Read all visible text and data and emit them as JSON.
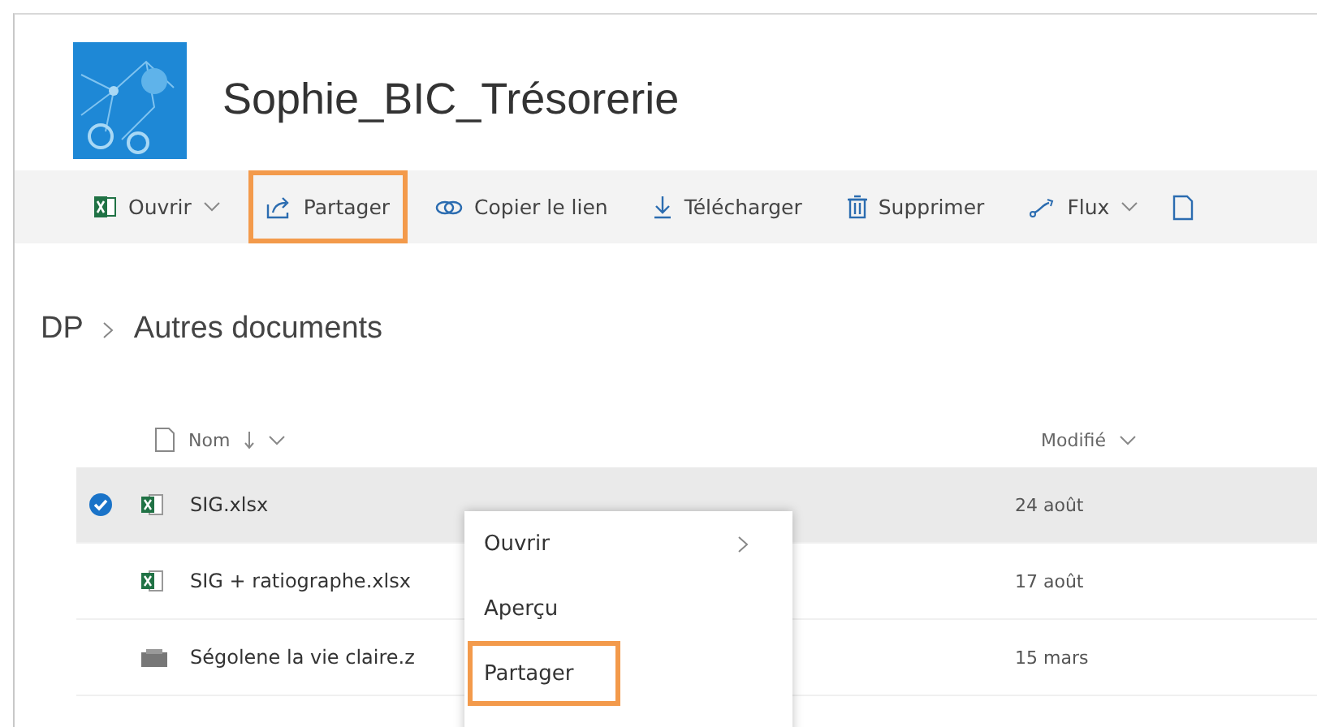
{
  "site": {
    "title": "Sophie_BIC_Trésorerie"
  },
  "toolbar": [
    {
      "label": "Ouvrir",
      "kind": "excel",
      "dropdown": true,
      "highlighted": false
    },
    {
      "label": "Partager",
      "kind": "share",
      "dropdown": false,
      "highlighted": true
    },
    {
      "label": "Copier le lien",
      "kind": "link",
      "dropdown": false,
      "highlighted": false
    },
    {
      "label": "Télécharger",
      "kind": "download",
      "dropdown": false,
      "highlighted": false
    },
    {
      "label": "Supprimer",
      "kind": "delete",
      "dropdown": false,
      "highlighted": false
    },
    {
      "label": "Flux",
      "kind": "flow",
      "dropdown": true,
      "highlighted": false
    }
  ],
  "breadcrumb": [
    "DP",
    "Autres documents"
  ],
  "table": {
    "columns": [
      "Nom",
      "Modifié"
    ],
    "rows": [
      {
        "name": "SIG.xlsx",
        "modified": "24 août",
        "kind": "excel",
        "selected": true
      },
      {
        "name": "SIG + ratiographe.xlsx",
        "modified": "17 août",
        "kind": "excel",
        "selected": false
      },
      {
        "name": "Ségolene la vie claire.z",
        "modified": "15 mars",
        "kind": "archive",
        "selected": false
      }
    ]
  },
  "context_menu": [
    {
      "label": "Ouvrir",
      "submenu": true,
      "highlighted": false
    },
    {
      "label": "Aperçu",
      "submenu": false,
      "highlighted": false
    },
    {
      "label": "Partager",
      "submenu": false,
      "highlighted": true
    }
  ]
}
